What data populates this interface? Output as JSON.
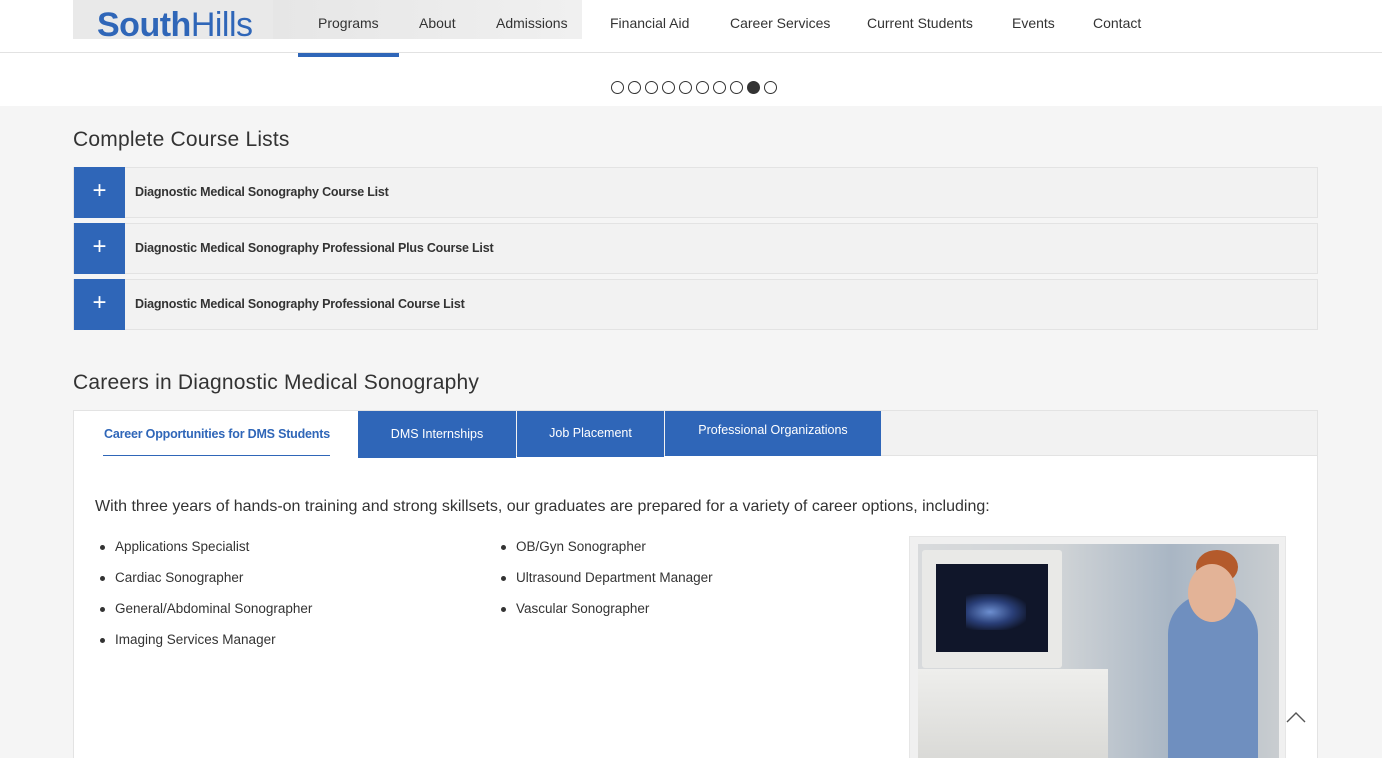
{
  "header": {
    "logo": {
      "bold": "South",
      "light": "Hills"
    },
    "nav": [
      "Programs",
      "About",
      "Admissions",
      "Financial Aid",
      "Career Services",
      "Current Students",
      "Events",
      "Contact"
    ],
    "active_nav": "Programs"
  },
  "slider": {
    "dot_count": 10,
    "active_index": 8
  },
  "course_lists": {
    "title": "Complete Course Lists",
    "items": [
      {
        "icon": "plus-icon",
        "label": "Diagnostic Medical Sonography Course List"
      },
      {
        "icon": "plus-icon",
        "label": "Diagnostic Medical Sonography Professional Plus Course List"
      },
      {
        "icon": "plus-icon",
        "label": "Diagnostic Medical Sonography Professional Course List"
      }
    ]
  },
  "careers": {
    "title": "Careers in Diagnostic Medical Sonography",
    "tabs": [
      "Career Opportunities for DMS Students",
      "DMS Internships",
      "Job Placement",
      "Professional Organizations"
    ],
    "active_tab": 0,
    "intro": "With three years of hands-on training and strong skillsets, our graduates are prepared for a variety of career options, including:",
    "col1": [
      "Applications Specialist",
      "Cardiac Sonographer",
      "General/Abdominal Sonographer",
      "Imaging Services Manager"
    ],
    "col2": [
      "OB/Gyn Sonographer",
      "Ultrasound Department Manager",
      "Vascular Sonographer"
    ],
    "photo_icon": "sonographer-photo"
  },
  "scroll_top_icon": "chevron-up-icon",
  "colors": {
    "brand": "#2f66b8",
    "panel_bg": "#f2f2f2",
    "page_bg": "#f5f5f5"
  }
}
